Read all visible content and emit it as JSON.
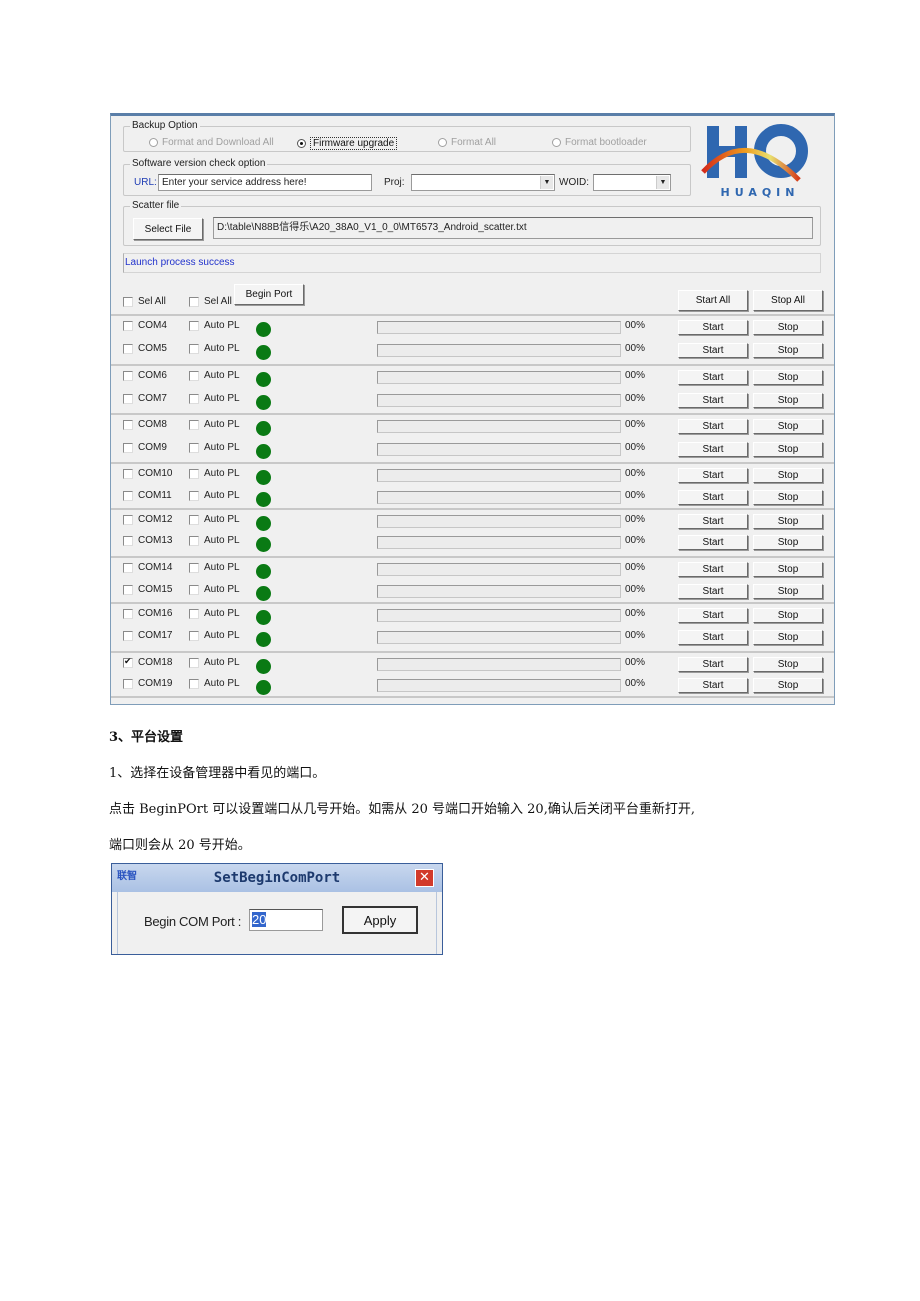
{
  "app": {
    "backup_option": {
      "legend": "Backup Option",
      "options": [
        {
          "label": "Format and Download All",
          "selected": false
        },
        {
          "label": "Firmware upgrade",
          "selected": true
        },
        {
          "label": "Format All",
          "selected": false
        },
        {
          "label": "Format bootloader",
          "selected": false
        }
      ]
    },
    "version_check": {
      "legend": "Software version check option",
      "url_label": "URL:",
      "url_value": "Enter your service address here!",
      "proj_label": "Proj:",
      "proj_value": "",
      "woid_label": "WOID:",
      "woid_value": ""
    },
    "scatter": {
      "legend": "Scatter file",
      "select_button": "Select File",
      "path": "D:\\table\\N88B信得乐\\A20_38A0_V1_0_0\\MT6573_Android_scatter.txt"
    },
    "logo": {
      "text": "HUAQIN",
      "mark": "HQ",
      "brand_color": "#2f67b0"
    },
    "status_text": "Launch process success",
    "header": {
      "sel_all_1": "Sel All",
      "sel_all_2": "Sel All",
      "begin_port": "Begin Port",
      "start_all": "Start All",
      "stop_all": "Stop All"
    },
    "auto_label": "Auto PL",
    "start_label": "Start",
    "stop_label": "Stop",
    "led_color": "#0a7a14",
    "ports": [
      {
        "name": "COM4",
        "checked": false,
        "auto": false,
        "progress": "00%"
      },
      {
        "name": "COM5",
        "checked": false,
        "auto": false,
        "progress": "00%"
      },
      {
        "name": "COM6",
        "checked": false,
        "auto": false,
        "progress": "00%"
      },
      {
        "name": "COM7",
        "checked": false,
        "auto": false,
        "progress": "00%"
      },
      {
        "name": "COM8",
        "checked": false,
        "auto": false,
        "progress": "00%"
      },
      {
        "name": "COM9",
        "checked": false,
        "auto": false,
        "progress": "00%"
      },
      {
        "name": "COM10",
        "checked": false,
        "auto": false,
        "progress": "00%"
      },
      {
        "name": "COM11",
        "checked": false,
        "auto": false,
        "progress": "00%"
      },
      {
        "name": "COM12",
        "checked": false,
        "auto": false,
        "progress": "00%"
      },
      {
        "name": "COM13",
        "checked": false,
        "auto": false,
        "progress": "00%"
      },
      {
        "name": "COM14",
        "checked": false,
        "auto": false,
        "progress": "00%"
      },
      {
        "name": "COM15",
        "checked": false,
        "auto": false,
        "progress": "00%"
      },
      {
        "name": "COM16",
        "checked": false,
        "auto": false,
        "progress": "00%"
      },
      {
        "name": "COM17",
        "checked": false,
        "auto": false,
        "progress": "00%"
      },
      {
        "name": "COM18",
        "checked": true,
        "auto": false,
        "progress": "00%"
      },
      {
        "name": "COM19",
        "checked": false,
        "auto": false,
        "progress": "00%"
      }
    ]
  },
  "doc": {
    "heading": "3、平台设置",
    "line1": "1、选择在设备管理器中看见的端口。",
    "line2": "点击 BeginPOrt 可以设置端口从几号开始。如需从 20 号端口开始输入 20,确认后关闭平台重新打开,",
    "line3": "端口则会从 20 号开始。"
  },
  "dialog": {
    "app_icon_text": "联智",
    "title": "SetBeginComPort",
    "close": "✕",
    "label": "Begin COM Port :",
    "value": "20",
    "apply": "Apply"
  }
}
